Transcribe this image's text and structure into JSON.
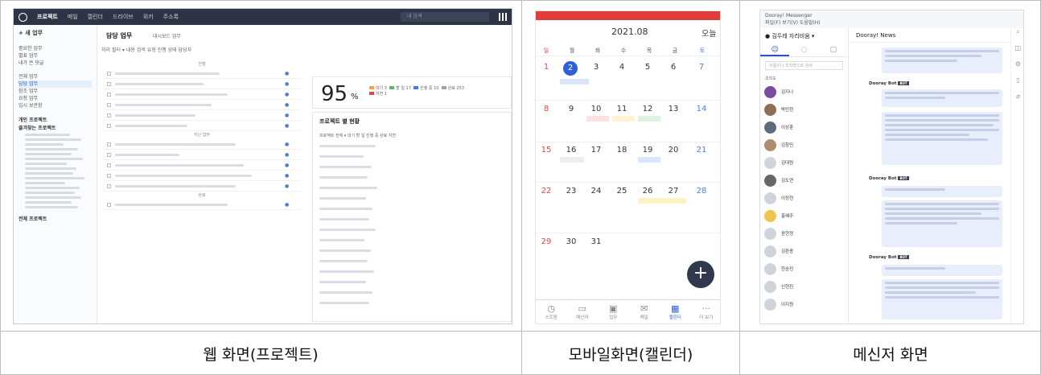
{
  "captions": {
    "web": "웹 화면(프로젝트)",
    "mobile": "모바일화면(캘린더)",
    "messenger": "메신저 화면"
  },
  "web": {
    "nav_tabs": [
      "프로젝트",
      "메일",
      "캘린더",
      "드라이브",
      "위키",
      "주소록"
    ],
    "search_placeholder": "내 검색",
    "new_task": "+ 새 업무",
    "sidebar_top": [
      "중요한 업무",
      "별표 업무",
      "내가 쓴 댓글"
    ],
    "sidebar_mid": [
      "전체 업무",
      "담당 업무",
      "참조 업무",
      "요청 업무",
      "임시 보관함"
    ],
    "sidebar_section": "개인 프로젝트",
    "sidebar_section2": "즐겨찾는 프로젝트",
    "sidebar_bottom": "전체 프로젝트",
    "header": "담당 업무",
    "header_tabs": "대시보드   업무",
    "filters": "처리 필터 ▾   내용 검색   유형  진행 상태  담당자",
    "group_labels": [
      "진행",
      "지난 업무",
      "완료"
    ],
    "percent": "95",
    "percent_unit": "%",
    "legend": [
      "대기 3",
      "할 일 17",
      "진행 중 10",
      "완료 253",
      "지연 1"
    ],
    "status_header": "프로젝트 별 현황",
    "status_cols": "프로젝트   전체 ▾   대기   할 일   진행 중   완료   지연"
  },
  "mobile": {
    "month": "2021.08",
    "today": "오늘",
    "weekdays": [
      "일",
      "월",
      "화",
      "수",
      "목",
      "금",
      "토"
    ],
    "days": [
      "1",
      "2",
      "3",
      "4",
      "5",
      "6",
      "7",
      "8",
      "9",
      "10",
      "11",
      "12",
      "13",
      "14",
      "15",
      "16",
      "17",
      "18",
      "19",
      "20",
      "21",
      "22",
      "23",
      "24",
      "25",
      "26",
      "27",
      "28",
      "29",
      "30",
      "31"
    ],
    "nav": [
      "스트림",
      "메신저",
      "업무",
      "메일",
      "캘린더",
      "더 보기"
    ],
    "fab": "+"
  },
  "messenger": {
    "title": "Dooray! Messenger",
    "menu": "파일(F)   보기(V)   도움말(H)",
    "me": "● 김두레  자리비움 ▾",
    "chat_title": "Dooray! News",
    "search_placeholder": "이름이나 조직명으로 검색",
    "org_label": "조직도",
    "bot_name": "Dooray Bot",
    "bot_tag": "BOT",
    "people": [
      "김지나",
      "박민현",
      "이상훈",
      "김창민",
      "김대원",
      "김도연",
      "이정현",
      "홍혜주",
      "윤현정",
      "김환종",
      "한승진",
      "신현진",
      "이지원"
    ]
  }
}
